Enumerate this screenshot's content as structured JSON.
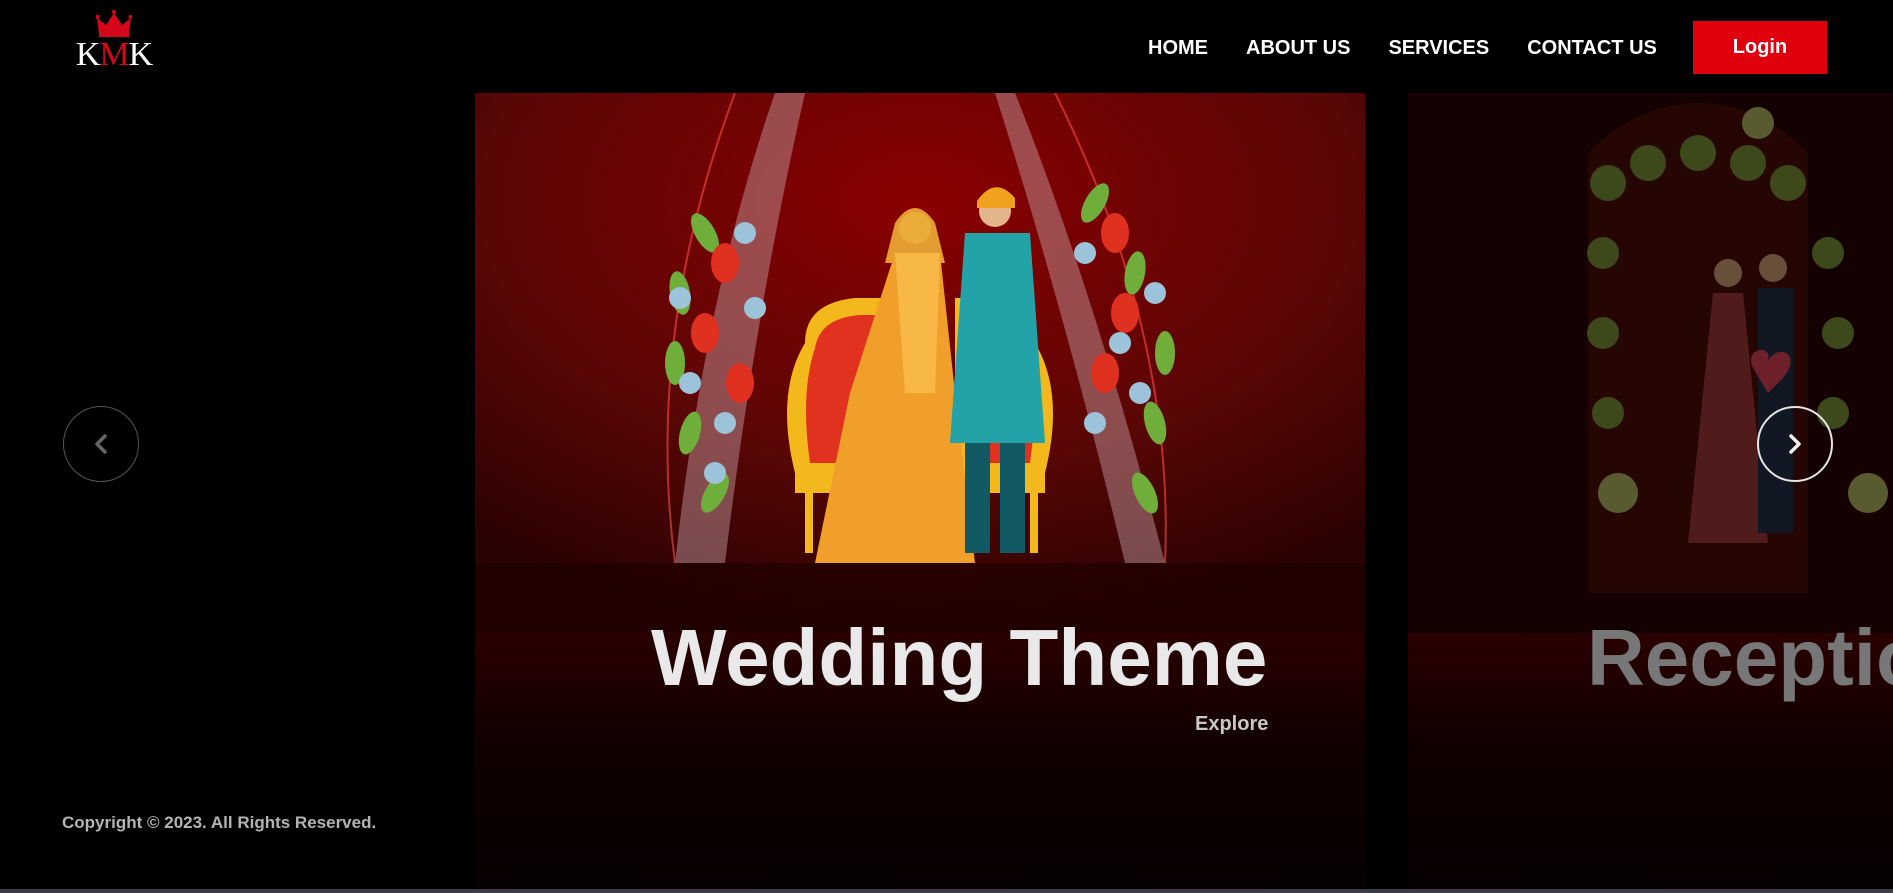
{
  "logo": {
    "letter_1": "K",
    "letter_2": "M",
    "letter_3": "K"
  },
  "nav": {
    "items": [
      {
        "label": "HOME"
      },
      {
        "label": "ABOUT US"
      },
      {
        "label": "SERVICES"
      },
      {
        "label": "CONTACT US"
      }
    ],
    "login_label": "Login"
  },
  "carousel": {
    "active_slide": {
      "title": "Wedding Theme",
      "link": "Explore"
    },
    "next_slide": {
      "title": "Receptio"
    },
    "prev_icon": "chevron-left-icon",
    "next_icon": "chevron-right-icon"
  },
  "footer": {
    "copyright": "Copyright © 2023. All Rights Reserved."
  },
  "colors": {
    "accent": "#e0000d",
    "background": "#000000",
    "logo_red": "#d4081a"
  }
}
